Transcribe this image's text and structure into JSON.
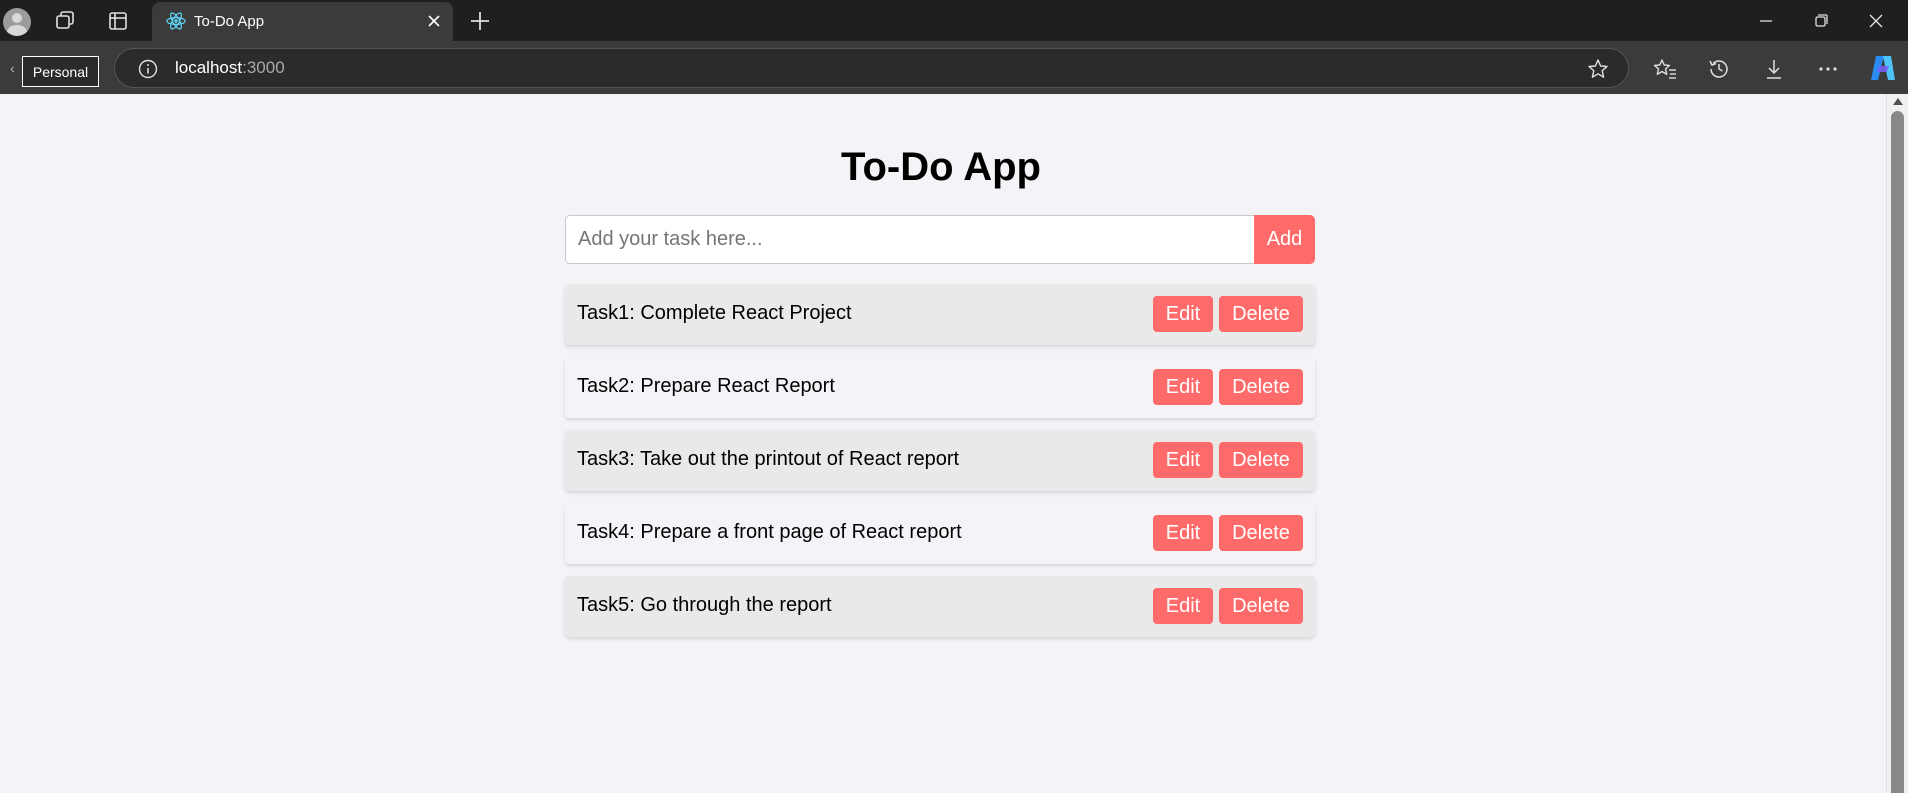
{
  "browser": {
    "profile_icon": "profile-avatar-icon",
    "tab": {
      "title": "To-Do App",
      "favicon": "react-icon"
    },
    "profile_badge": "Personal",
    "address": {
      "host": "localhost",
      "port": ":3000"
    },
    "icons": [
      "workspaces-icon",
      "tab-actions-icon",
      "close-icon",
      "plus-icon",
      "minimize-icon",
      "restore-icon",
      "info-icon",
      "star-icon",
      "favorites-icon",
      "history-icon",
      "download-icon",
      "more-icon",
      "copilot-icon"
    ]
  },
  "app": {
    "title": "To-Do App",
    "input": {
      "placeholder": "Add your task here...",
      "value": ""
    },
    "add_label": "Add",
    "edit_label": "Edit",
    "delete_label": "Delete",
    "tasks": [
      "Task1: Complete React Project",
      "Task2: Prepare React Report",
      "Task3: Take out the printout of React report",
      "Task4: Prepare a front page of React report",
      "Task5: Go through the report"
    ]
  },
  "colors": {
    "accent": "#ff6b6b",
    "page_background": "#f4f4f8",
    "row_alt": "#e9e9e9",
    "chrome_dark": "#1f1f1f",
    "chrome_toolbar": "#3b3b3b"
  }
}
